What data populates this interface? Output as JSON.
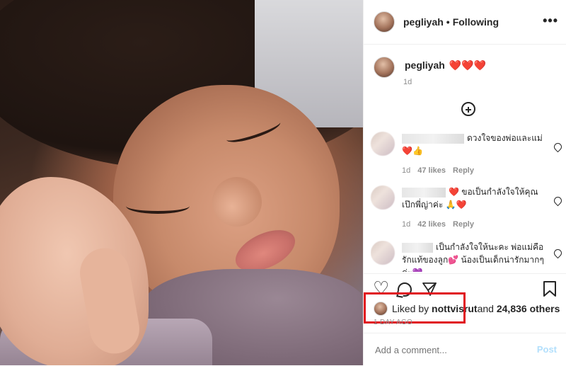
{
  "post": {
    "username": "pegliyah",
    "follow_status": "Following",
    "more": "•••"
  },
  "caption": {
    "username": "pegliyah",
    "text": "❤️❤️❤️",
    "time": "1d"
  },
  "comments": [
    {
      "text": "ดวงใจของพ่อและแม่ ❤️👍",
      "time": "1d",
      "likes": "47 likes",
      "reply": "Reply"
    },
    {
      "text": "❤️ ขอเป็นกำลังใจให้คุณเป๊กพี่ญ่าค่ะ 🙏❤️",
      "time": "1d",
      "likes": "42 likes",
      "reply": "Reply"
    },
    {
      "text": "เป็นกำลังใจให้นะคะ พ่อแม่คือรักแท้ของลูก💕 น้องเป็นเด็กน่ารักมากๆค่ะ💜",
      "time": "",
      "likes": "",
      "reply": ""
    }
  ],
  "likes": {
    "prefix": "Liked by ",
    "user": "nottvisrut",
    "suffix": " and ",
    "others": "24,836 others"
  },
  "date": "1 DAY AGO",
  "add_comment": {
    "placeholder": "Add a comment...",
    "post_label": "Post"
  },
  "colors": {
    "highlight_box": "#e0141e",
    "heart": "#e0245e",
    "post_disabled": "#b2dffc"
  }
}
